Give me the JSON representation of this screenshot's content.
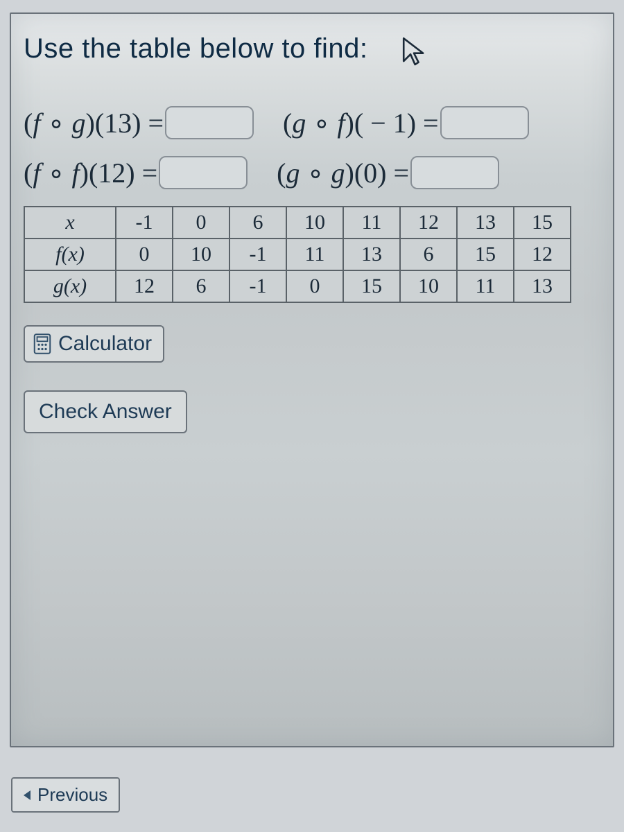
{
  "title": "Use the table below to find:",
  "questions": {
    "fog13": {
      "label_html": "(f ∘ g)(13) =",
      "value": ""
    },
    "gof_neg1": {
      "label_html": "(g ∘ f)( − 1) =",
      "value": ""
    },
    "fof12": {
      "label_html": "(f ∘ f)(12) =",
      "value": ""
    },
    "gog0": {
      "label_html": "(g ∘ g)(0) =",
      "value": ""
    }
  },
  "table": {
    "row_labels": [
      "x",
      "f(x)",
      "g(x)"
    ],
    "x": [
      "-1",
      "0",
      "6",
      "10",
      "11",
      "12",
      "13",
      "15"
    ],
    "fx": [
      "0",
      "10",
      "-1",
      "11",
      "13",
      "6",
      "15",
      "12"
    ],
    "gx": [
      "12",
      "6",
      "-1",
      "0",
      "15",
      "10",
      "11",
      "13"
    ]
  },
  "buttons": {
    "calculator": "Calculator",
    "check": "Check Answer",
    "previous": "Previous"
  }
}
